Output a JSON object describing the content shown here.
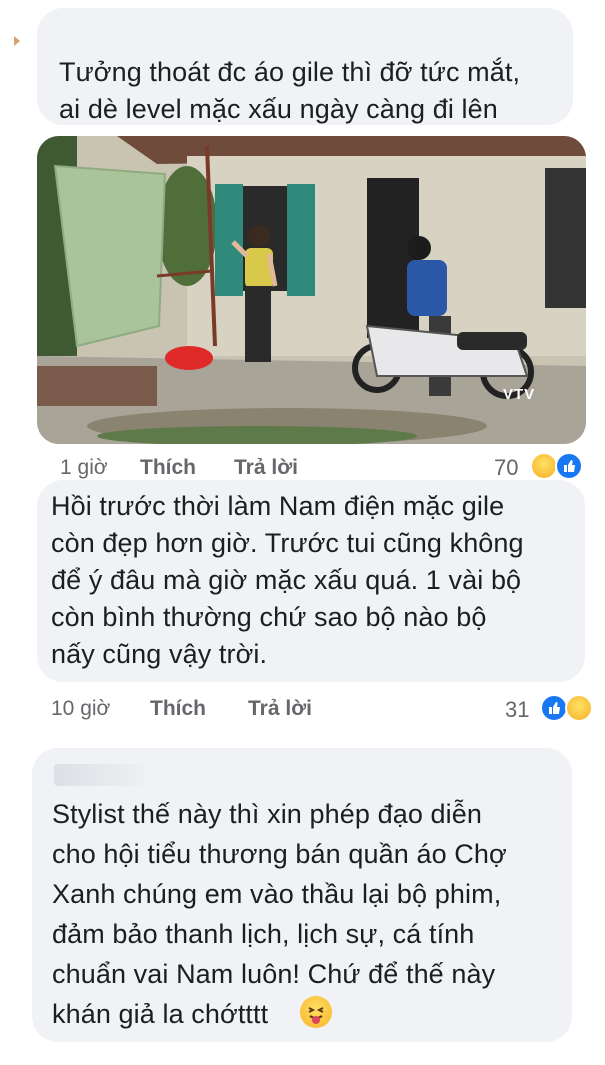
{
  "comments": [
    {
      "text": "Tưởng thoát đc áo gile thì đỡ tức mắt,\nai dè level mặc xấu ngày càng đi lên",
      "time": "1 giờ",
      "like": "Thích",
      "reply": "Trả lời",
      "reaction_count": "70",
      "reactions": [
        "haha-emoji",
        "like-emoji"
      ]
    },
    {
      "text": "Hồi trước thời làm Nam điện mặc gile\ncòn đẹp hơn giờ. Trước tui cũng không\nđể ý đâu mà giờ mặc xấu quá. 1 vài bộ\ncòn bình thường chứ sao bộ nào bộ\nnấy cũng vậy trời.",
      "time": "10 giờ",
      "like": "Thích",
      "reply": "Trả lời",
      "reaction_count": "31",
      "reactions": [
        "like-emoji",
        "haha-emoji"
      ]
    },
    {
      "author": "C",
      "text": "Stylist thế này thì xin phép đạo diễn\ncho hội tiểu thương bán quần áo Chợ\nXanh chúng em vào thầu lại bộ phim,\nđảm bảo thanh lịch, lịch sự, cá tính\nchuẩn vai Nam luôn! Chứ để thế này\nkhán giả la chớtttt",
      "trailing_emoji": "tongue-out-emoji"
    }
  ],
  "photo": {
    "watermark": "VTV"
  },
  "colors": {
    "bubble": "#f0f2f5",
    "meta_text": "#65676b",
    "like_blue": "#1877f2",
    "haha_yellow": "#f7b125"
  }
}
